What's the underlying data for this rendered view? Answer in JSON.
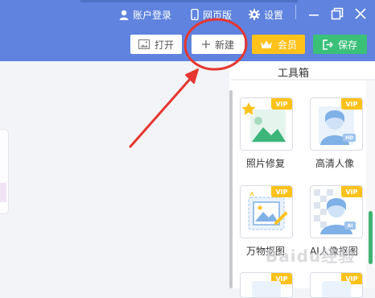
{
  "header": {
    "account_label": "账户登录",
    "web_label": "网页版",
    "settings_label": "设置"
  },
  "toolbar": {
    "open_label": "打开",
    "new_label": "新建",
    "vip_label": "会员",
    "save_label": "保存"
  },
  "toolbox": {
    "title": "工具箱",
    "items": [
      {
        "label": "照片修复",
        "badge": "VIP",
        "icon": "photo-restore-icon"
      },
      {
        "label": "高清人像",
        "badge": "VIP",
        "icon": "hd-portrait-icon",
        "sub_badge": "HD"
      },
      {
        "label": "万物抠图",
        "badge": "VIP",
        "icon": "object-cutout-icon"
      },
      {
        "label": "AI人像抠图",
        "badge": "VIP",
        "icon": "ai-portrait-cutout-icon",
        "sub_badge": "AI"
      }
    ]
  },
  "watermark": "Baidu经验",
  "colors": {
    "header": "#5f83de",
    "vip": "#ffc21b",
    "save": "#3bc07a",
    "annotation": "#e5362f"
  }
}
